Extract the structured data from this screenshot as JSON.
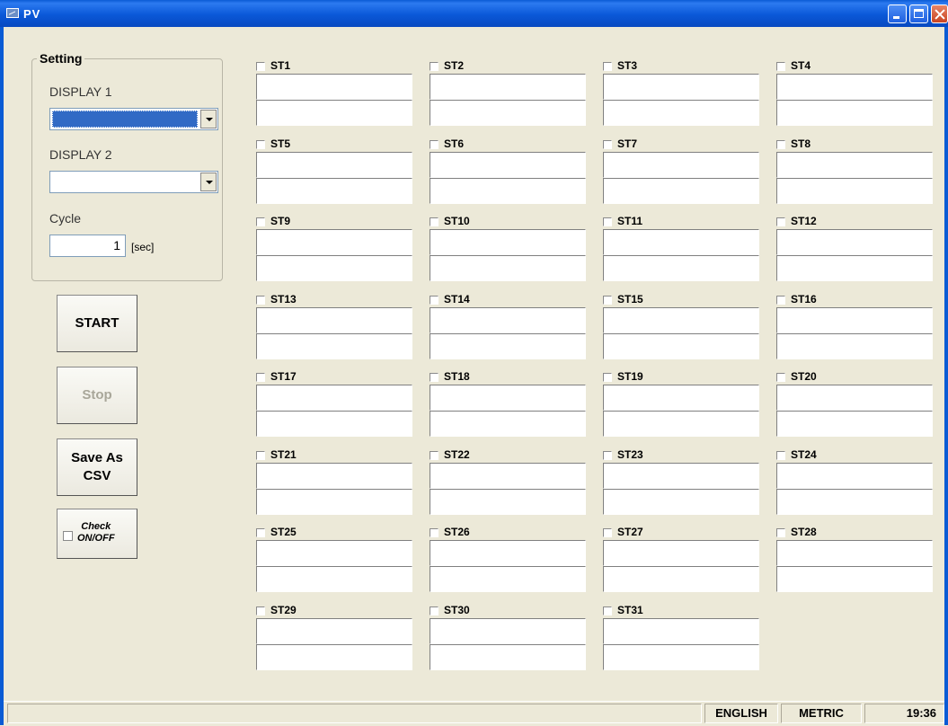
{
  "window": {
    "title": "PV"
  },
  "setting": {
    "legend": "Setting",
    "display1_label": "DISPLAY 1",
    "display1_value": "",
    "display2_label": "DISPLAY 2",
    "display2_value": "",
    "cycle_label": "Cycle",
    "cycle_value": "1",
    "cycle_unit": "[sec]"
  },
  "buttons": {
    "start": "START",
    "stop": "Stop",
    "save_line1": "Save As",
    "save_line2": "CSV",
    "check_line1": "Check",
    "check_line2": "ON/OFF"
  },
  "stations": [
    "ST1",
    "ST2",
    "ST3",
    "ST4",
    "ST5",
    "ST6",
    "ST7",
    "ST8",
    "ST9",
    "ST10",
    "ST11",
    "ST12",
    "ST13",
    "ST14",
    "ST15",
    "ST16",
    "ST17",
    "ST18",
    "ST19",
    "ST20",
    "ST21",
    "ST22",
    "ST23",
    "ST24",
    "ST25",
    "ST26",
    "ST27",
    "ST28",
    "ST29",
    "ST30",
    "ST31"
  ],
  "statusbar": {
    "message": "",
    "language": "ENGLISH",
    "units": "METRIC",
    "time": "19:36"
  }
}
